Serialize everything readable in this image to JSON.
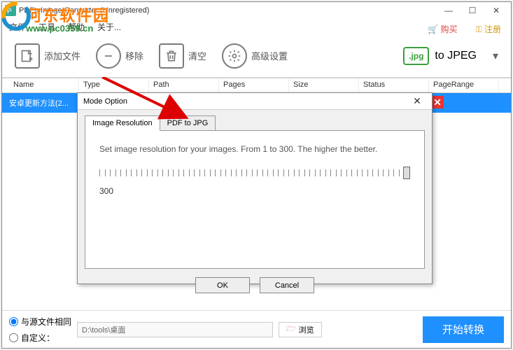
{
  "window": {
    "title": "PDFtoImage Converter (Unregistered)"
  },
  "menu": {
    "file": "文件",
    "tools": "工具",
    "help": "帮助",
    "about": "关于..."
  },
  "watermark": {
    "line1": "河东软件园",
    "line2": "www.pc0359.cn"
  },
  "header_links": {
    "buy": "购买",
    "register": "注册"
  },
  "toolbar": {
    "add": "添加文件",
    "remove": "移除",
    "clear": "清空",
    "advanced": "高级设置",
    "format_badge": ".jpg",
    "format_label": "to JPEG"
  },
  "table": {
    "headers": {
      "name": "Name",
      "type": "Type",
      "path": "Path",
      "pages": "Pages",
      "size": "Size",
      "status": "Status",
      "range": "PageRange"
    },
    "rows": [
      {
        "name": "安卓更新方法(2..."
      }
    ]
  },
  "bottom": {
    "same_as_source": "与源文件相同",
    "custom": "自定义：",
    "path_value": "D:\\tools\\桌面",
    "browse": "浏览",
    "convert": "开始转换"
  },
  "dialog": {
    "title": "Mode Option",
    "tabs": {
      "res": "Image Resolution",
      "pdf2jpg": "PDF to JPG"
    },
    "desc": "Set image resolution for your images. From 1 to 300.  The higher the better.",
    "value": "300",
    "ok": "OK",
    "cancel": "Cancel"
  }
}
